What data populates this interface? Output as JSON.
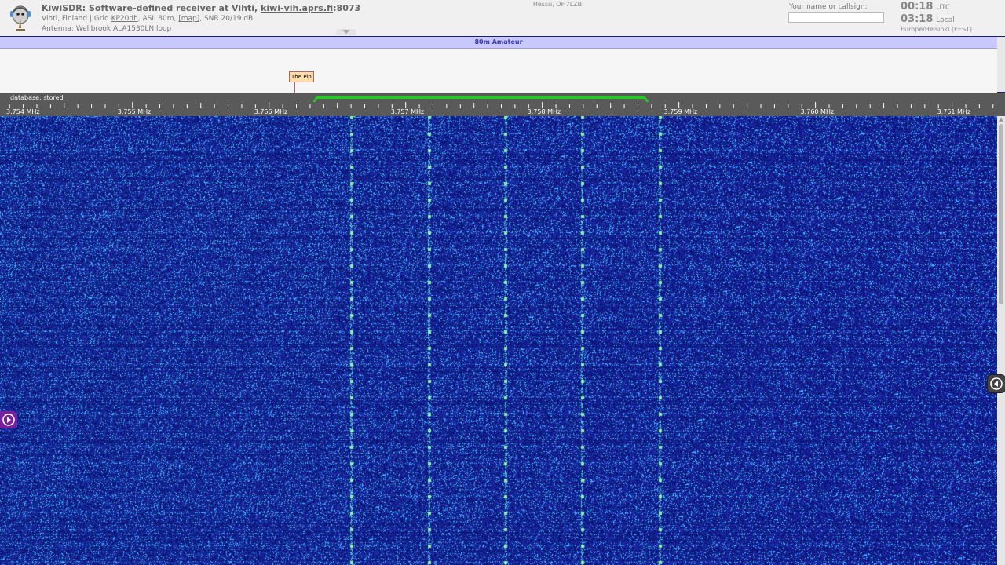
{
  "header": {
    "title_prefix": "KiwiSDR: Software-defined receiver at Vihti, ",
    "title_host": "kiwi-vih.aprs.fi",
    "title_port": ":8073",
    "info_location": "Vihti, Finland | Grid ",
    "info_grid": "KP20dh",
    "info_asl": ", ASL 80m, ",
    "info_map": "[map]",
    "info_snr": ", SNR 20/19 dB",
    "antenna": "Antenna: Wellbrook ALA1530LN loop",
    "owner": "Hessu, OH7LZB",
    "callsign_label": "Your name or callsign:",
    "callsign_value": "",
    "utc_time": "00:18",
    "utc_label": "UTC",
    "local_time": "03:18",
    "local_label": "Local",
    "timezone": "Europe/Helsinki (EEST)"
  },
  "band": {
    "name": "80m Amateur",
    "color": "#c8c8ff"
  },
  "dx": {
    "label": "The Pip",
    "freq_mhz": 3.756
  },
  "scale": {
    "database_label": "database: stored",
    "start_mhz": 3.75403,
    "end_mhz": 3.76133,
    "labels": [
      {
        "mhz": 3.754,
        "text": "3.754 MHz"
      },
      {
        "mhz": 3.755,
        "text": "3.755 MHz"
      },
      {
        "mhz": 3.756,
        "text": "3.756 MHz"
      },
      {
        "mhz": 3.757,
        "text": "3.757 MHz"
      },
      {
        "mhz": 3.758,
        "text": "3.758 MHz"
      },
      {
        "mhz": 3.759,
        "text": "3.759 MHz"
      },
      {
        "mhz": 3.76,
        "text": "3.760 MHz"
      },
      {
        "mhz": 3.761,
        "text": "3.761 MHz"
      }
    ],
    "passband_mhz": [
      3.75632,
      3.75878
    ],
    "passband_color": "#22cc22"
  },
  "waterfall": {
    "background": "#1e23a4",
    "signal_color": "#7cf5a0",
    "signals_mhz": [
      3.7566,
      3.75717,
      3.75773,
      3.75829,
      3.75886
    ]
  },
  "icons": {
    "logo": "kiwi-bird-logo-icon",
    "expand": "chevron-down-icon",
    "right": "collapse-panel-right-icon",
    "left": "expand-panel-left-icon"
  }
}
